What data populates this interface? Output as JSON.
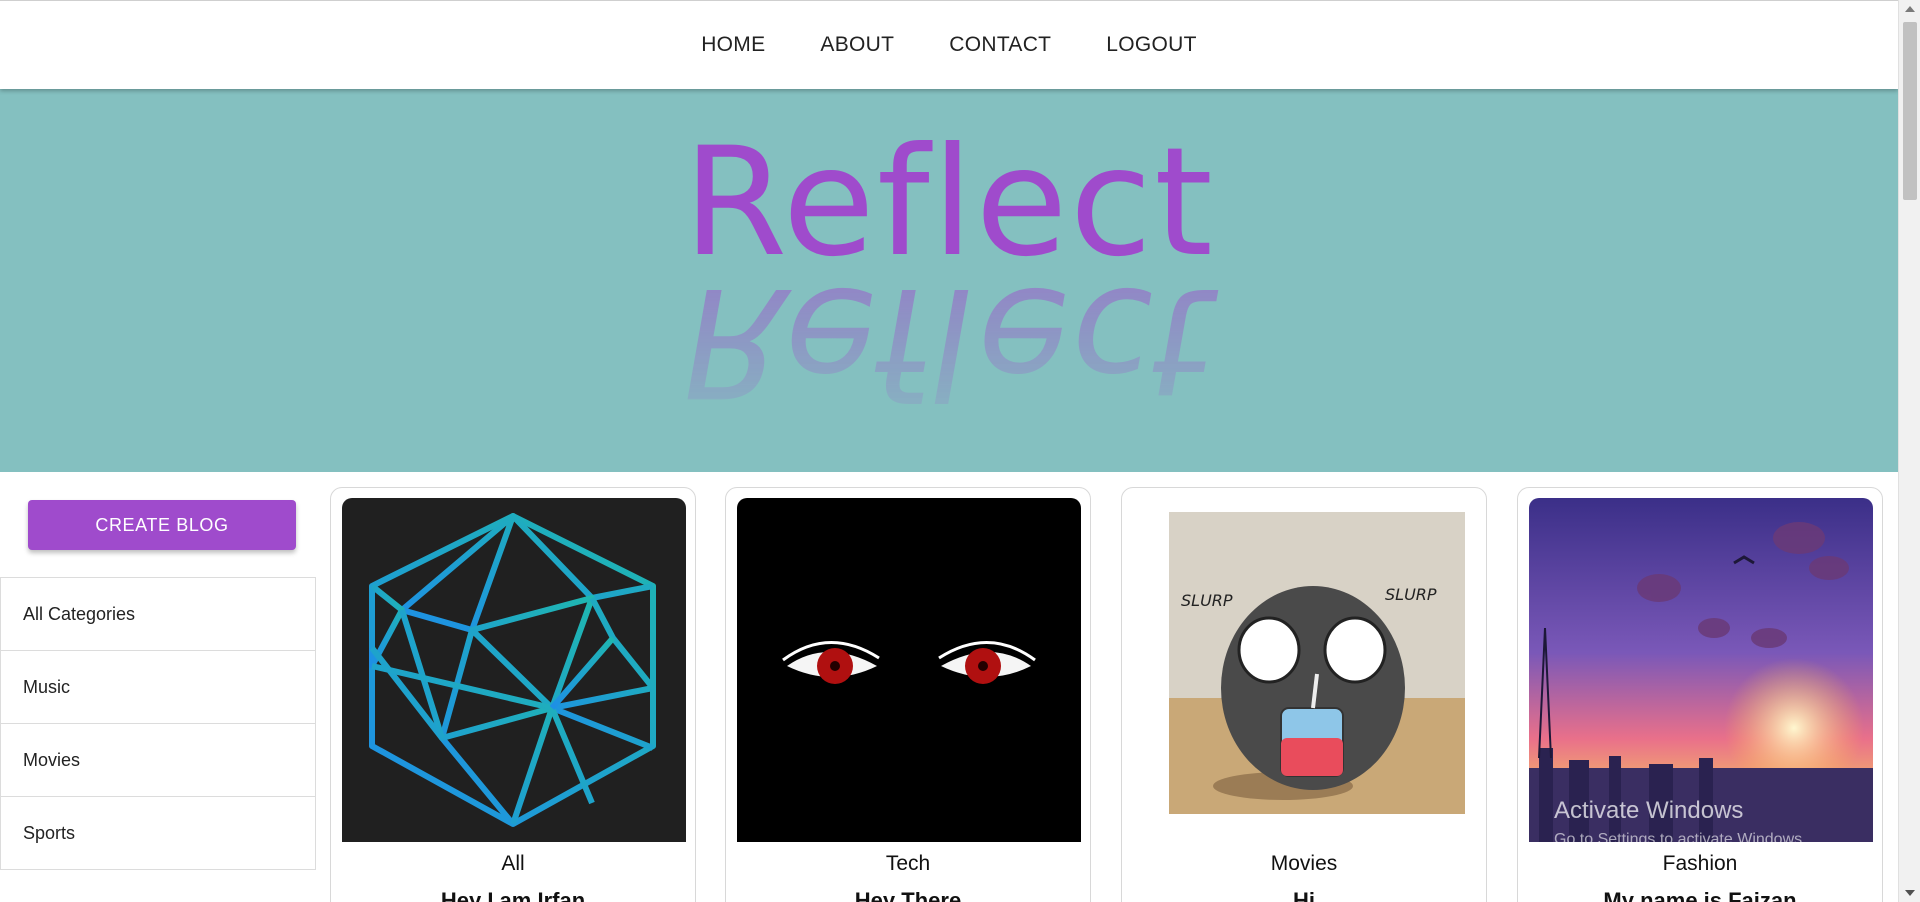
{
  "nav": {
    "links": [
      "HOME",
      "ABOUT",
      "CONTACT",
      "LOGOUT"
    ]
  },
  "hero": {
    "title": "Reflect",
    "background": "#84c0c0",
    "title_color": "#9f4bcc"
  },
  "sidebar": {
    "create_label": "CREATE BLOG",
    "categories": [
      "All Categories",
      "Music",
      "Movies",
      "Sports"
    ]
  },
  "cards": [
    {
      "category": "All",
      "title": "Hey I am Irfan",
      "image": "hexagon-logo-image"
    },
    {
      "category": "Tech",
      "title": "Hey There",
      "image": "red-eyes-image"
    },
    {
      "category": "Movies",
      "title": "Hi",
      "image": "cartoon-slurp-image"
    },
    {
      "category": "Fashion",
      "title": "My name is Faizan",
      "image": "sunset-city-image"
    }
  ],
  "slurp_text": "SLURP",
  "watermark": {
    "title": "Activate Windows",
    "subtitle": "Go to Settings to activate Windows."
  }
}
